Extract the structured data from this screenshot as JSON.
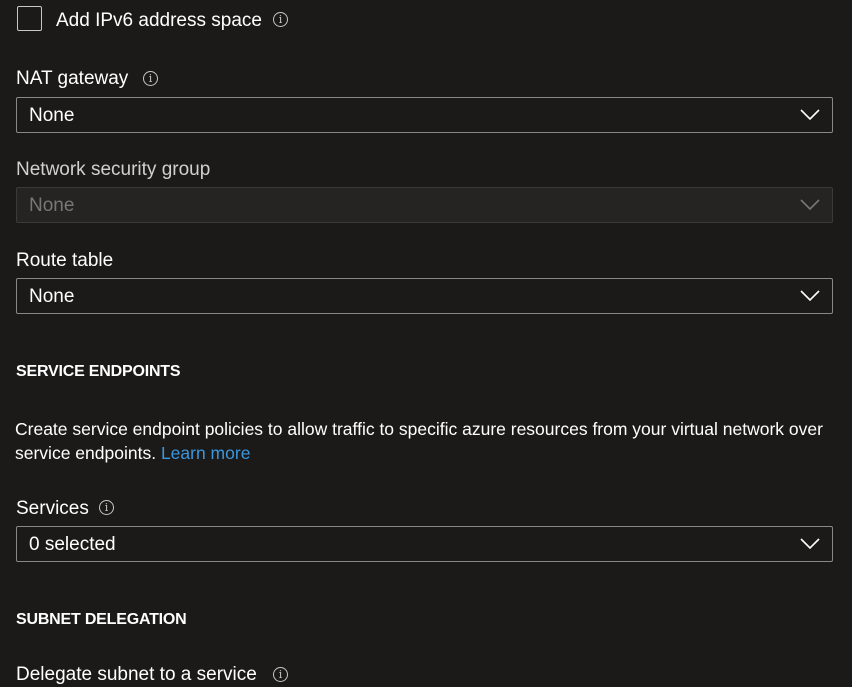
{
  "ipv6": {
    "label": "Add IPv6 address space",
    "checked": false
  },
  "nat_gateway": {
    "label": "NAT gateway",
    "value": "None"
  },
  "network_security_group": {
    "label": "Network security group",
    "value": "None",
    "disabled": true
  },
  "route_table": {
    "label": "Route table",
    "value": "None"
  },
  "service_endpoints": {
    "heading": "SERVICE ENDPOINTS",
    "description": "Create service endpoint policies to allow traffic to specific azure resources from your virtual network over service endpoints.",
    "learn_more": "Learn more",
    "services": {
      "label": "Services",
      "value": "0 selected"
    }
  },
  "subnet_delegation": {
    "heading": "SUBNET DELEGATION",
    "delegate_label": "Delegate subnet to a service"
  },
  "icons": {
    "info": "info-icon",
    "chevron": "chevron-down-icon"
  },
  "colors": {
    "background": "#1b1a19",
    "text": "#ffffff",
    "border": "#8a8886",
    "disabled_text": "#797775",
    "link": "#3a96dd"
  }
}
